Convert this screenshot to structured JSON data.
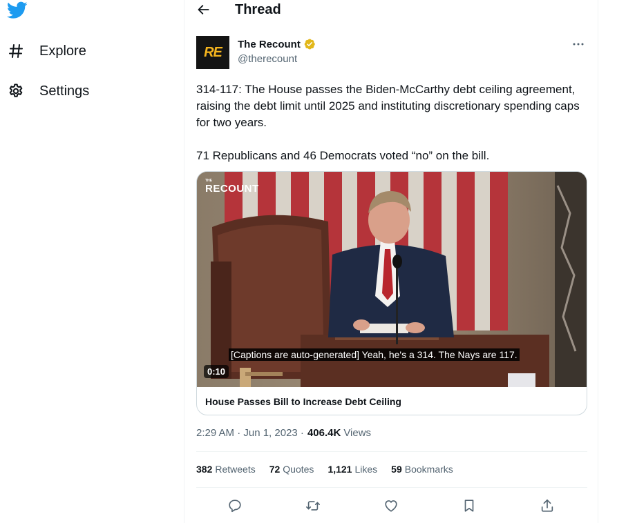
{
  "sidebar": {
    "logo_icon": "twitter-bird-icon",
    "brand_color": "#1d9bf0",
    "items": [
      {
        "label": "Explore",
        "icon": "hashtag-icon"
      },
      {
        "label": "Settings",
        "icon": "gear-icon"
      }
    ]
  },
  "header": {
    "back_icon": "arrow-left-icon",
    "title": "Thread"
  },
  "tweet": {
    "author": {
      "name": "The Recount",
      "handle": "@therecount",
      "avatar_text": "RE",
      "verified_color": "#e2b719"
    },
    "text": "314-117: The House passes the Biden-McCarthy debt ceiling agreement, raising the debt limit until 2025 and instituting discretionary spending caps for two years.\n\n71 Republicans and 46 Democrats voted “no” on the bill.",
    "media": {
      "watermark": "RECOUNT",
      "watermark_small": "THE",
      "caption": "[Captions are auto-generated] Yeah, he's a 314. The Nays are 117.",
      "duration": "0:10",
      "title": "House Passes Bill to Increase Debt Ceiling"
    },
    "timestamp": "2:29 AM · Jun 1, 2023 ·",
    "views_count": "406.4K",
    "views_label": "Views",
    "stats": {
      "retweets_count": "382",
      "retweets_label": "Retweets",
      "quotes_count": "72",
      "quotes_label": "Quotes",
      "likes_count": "1,121",
      "likes_label": "Likes",
      "bookmarks_count": "59",
      "bookmarks_label": "Bookmarks"
    }
  }
}
